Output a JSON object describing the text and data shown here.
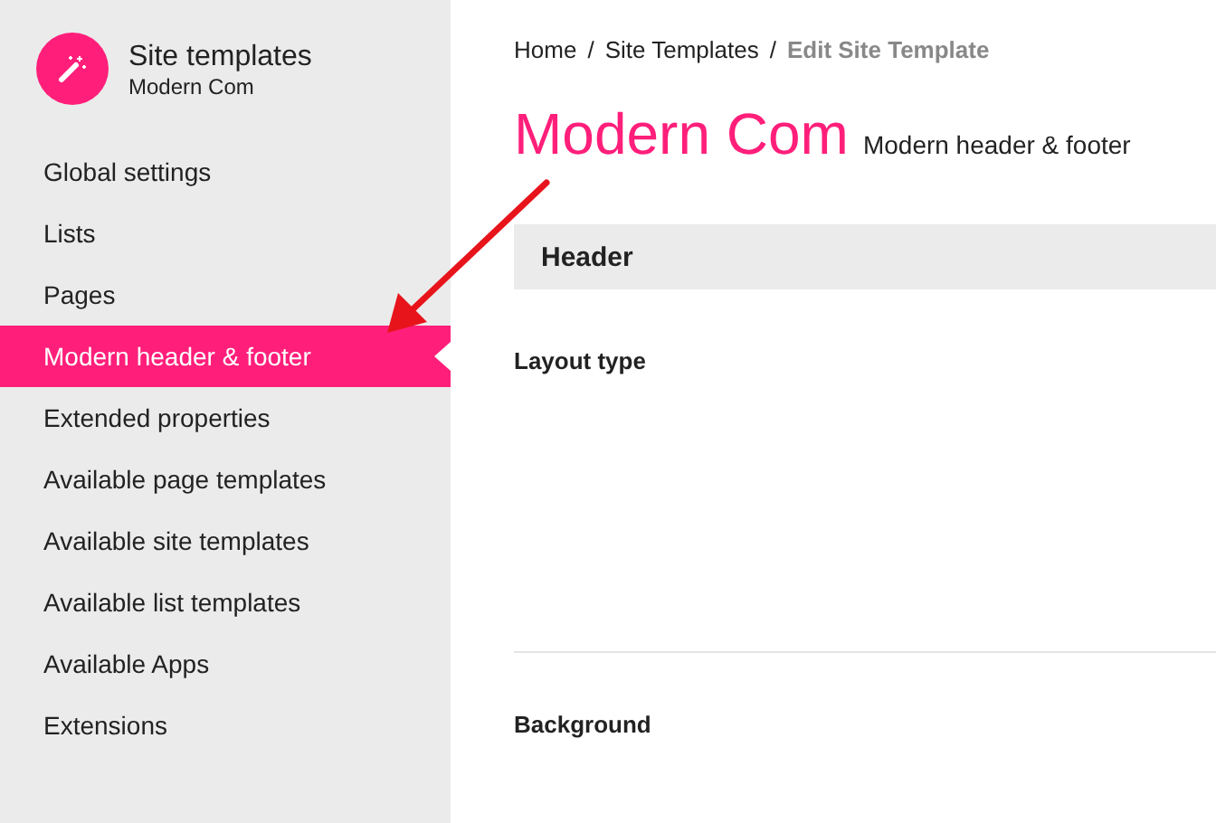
{
  "sidebar": {
    "title": "Site templates",
    "subtitle": "Modern Com",
    "items": [
      {
        "label": "Global settings",
        "selected": false
      },
      {
        "label": "Lists",
        "selected": false
      },
      {
        "label": "Pages",
        "selected": false
      },
      {
        "label": "Modern header & footer",
        "selected": true
      },
      {
        "label": "Extended properties",
        "selected": false
      },
      {
        "label": "Available page templates",
        "selected": false
      },
      {
        "label": "Available site templates",
        "selected": false
      },
      {
        "label": "Available list templates",
        "selected": false
      },
      {
        "label": "Available Apps",
        "selected": false
      },
      {
        "label": "Extensions",
        "selected": false
      }
    ]
  },
  "breadcrumb": [
    {
      "label": "Home",
      "current": false
    },
    {
      "label": "Site Templates",
      "current": false
    },
    {
      "label": "Edit Site Template",
      "current": true
    }
  ],
  "breadcrumb_separator": "/",
  "page": {
    "title": "Modern Com",
    "subtitle": "Modern header & footer"
  },
  "section": {
    "title": "Header"
  },
  "fields": [
    "Layout type",
    "Background"
  ]
}
